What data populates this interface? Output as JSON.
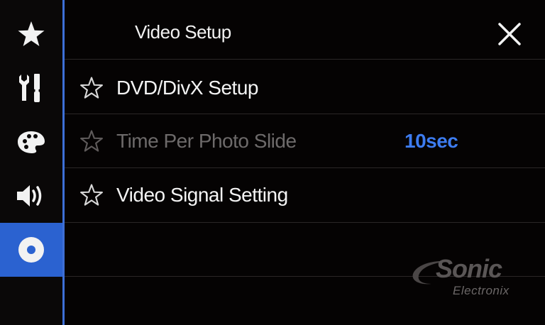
{
  "header": {
    "title": "Video Setup",
    "close_icon": "close-icon"
  },
  "sidebar": {
    "items": [
      {
        "icon": "star-icon",
        "active": false
      },
      {
        "icon": "tools-icon",
        "active": false
      },
      {
        "icon": "palette-icon",
        "active": false
      },
      {
        "icon": "speaker-icon",
        "active": false
      },
      {
        "icon": "disc-icon",
        "active": true
      }
    ]
  },
  "menu": {
    "items": [
      {
        "label": "DVD/DivX Setup",
        "value": "",
        "enabled": true
      },
      {
        "label": "Time Per Photo Slide",
        "value": "10sec",
        "enabled": false
      },
      {
        "label": "Video Signal Setting",
        "value": "",
        "enabled": true
      }
    ]
  },
  "watermark": {
    "brand": "Sonic",
    "sub": "Electronix"
  },
  "colors": {
    "accent": "#2b62d0",
    "value_text": "#3d7cf0",
    "disabled_text": "#6d6a6a"
  }
}
